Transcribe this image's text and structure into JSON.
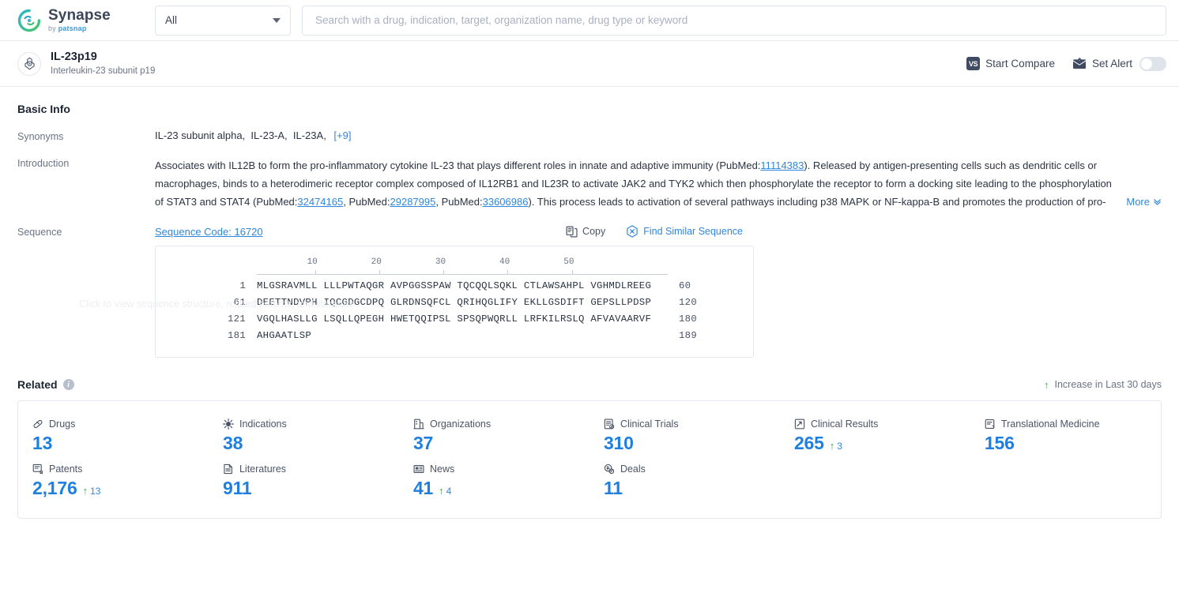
{
  "topbar": {
    "logo_name": "Synapse",
    "logo_sub_prefix": "by ",
    "logo_sub_brand": "patsnap",
    "scope_value": "All",
    "search_placeholder": "Search with a drug, indication, target, organization name, drug type or keyword",
    "search_value": ""
  },
  "entity": {
    "name": "IL-23p19",
    "alias": "Interleukin-23 subunit p19",
    "compare_label": "Start Compare",
    "alert_label": "Set Alert",
    "alert_enabled": false
  },
  "basic_info": {
    "title": "Basic Info",
    "synonyms_label": "Synonyms",
    "synonyms": [
      "IL-23 subunit alpha",
      "IL-23-A",
      "IL-23A"
    ],
    "synonyms_more": "[+9]",
    "introduction_label": "Introduction",
    "introduction_parts": [
      {
        "t": "text",
        "v": "Associates with IL12B to form the pro-inflammatory cytokine IL-23 that plays different roles in innate and adaptive immunity (PubMed:"
      },
      {
        "t": "link",
        "v": "11114383"
      },
      {
        "t": "text",
        "v": "). Released by antigen-presenting cells such as dendritic cells or macrophages, binds to a heterodimeric receptor complex composed of IL12RB1 and IL23R to activate JAK2 and TYK2 which then phosphorylate the receptor to form a docking site leading to the phosphorylation of STAT3 and STAT4 (PubMed:"
      },
      {
        "t": "link",
        "v": "32474165"
      },
      {
        "t": "text",
        "v": ", PubMed:"
      },
      {
        "t": "link",
        "v": "29287995"
      },
      {
        "t": "text",
        "v": ", PubMed:"
      },
      {
        "t": "link",
        "v": "33606986"
      },
      {
        "t": "text",
        "v": "). This process leads to activation of several pathways including p38 MAPK or NF-kappa-B and promotes the production of pro-"
      }
    ],
    "more_label": "More",
    "sequence_label": "Sequence",
    "sequence_code": "Sequence Code: 16720",
    "copy_label": "Copy",
    "find_similar_label": "Find Similar Sequence",
    "sequence_hint": "Click to view sequence structure, related patents, and literature"
  },
  "sequence": {
    "ruler_ticks": [
      10,
      20,
      30,
      40,
      50
    ],
    "lines": [
      {
        "start": "1",
        "chunks": "MLGSRAVMLL LLLPWTAQGR AVPGGSSPAW TQCQQLSQKL CTLAWSAHPL VGHMDLREEG",
        "end": "60"
      },
      {
        "start": "61",
        "chunks": "DEETTNDVPH IQCGDGCDPQ GLRDNSQFCL QRIHQGLIFY EKLLGSDIFT GEPSLLPDSP",
        "end": "120"
      },
      {
        "start": "121",
        "chunks": "VGQLHASLLG LSQLLQPEGH HWETQQIPSL SPSQPWQRLL LRFKILRSLQ AFVAVAARVF",
        "end": "180"
      },
      {
        "start": "181",
        "chunks": "AHGAATLSP",
        "end": "189"
      }
    ]
  },
  "related": {
    "title": "Related",
    "legend": "Increase in Last 30 days",
    "metrics": [
      {
        "label": "Drugs",
        "icon": "capsule-icon",
        "value": "13",
        "delta": null
      },
      {
        "label": "Indications",
        "icon": "virus-icon",
        "value": "38",
        "delta": null
      },
      {
        "label": "Organizations",
        "icon": "building-icon",
        "value": "37",
        "delta": null
      },
      {
        "label": "Clinical Trials",
        "icon": "clinical-trial-icon",
        "value": "310",
        "delta": null
      },
      {
        "label": "Clinical Results",
        "icon": "clinical-result-icon",
        "value": "265",
        "delta": "3"
      },
      {
        "label": "Translational Medicine",
        "icon": "translational-medicine-icon",
        "value": "156",
        "delta": null
      },
      {
        "label": "Patents",
        "icon": "patent-icon",
        "value": "2,176",
        "delta": "13"
      },
      {
        "label": "Literatures",
        "icon": "literature-icon",
        "value": "911",
        "delta": null
      },
      {
        "label": "News",
        "icon": "news-icon",
        "value": "41",
        "delta": "4"
      },
      {
        "label": "Deals",
        "icon": "deal-icon",
        "value": "11",
        "delta": null
      }
    ]
  },
  "colors": {
    "accent_blue": "#1f7fe0",
    "link_blue": "#2e86de",
    "increase_green": "#3aaa4a",
    "logo_teal": "#2ec4b6",
    "border": "#e4e8ee"
  }
}
